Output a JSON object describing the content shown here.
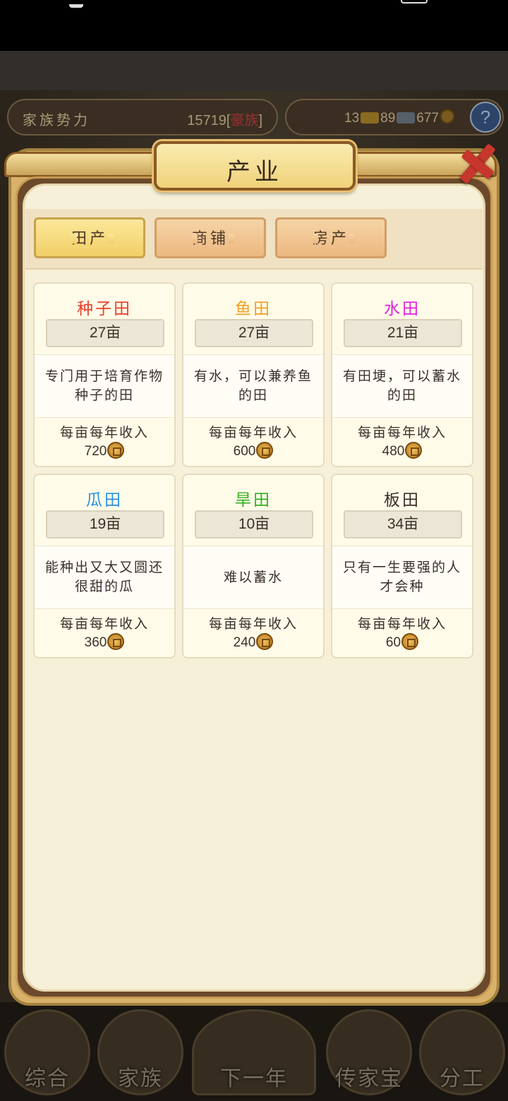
{
  "hud": {
    "power_label": "家族势力",
    "power_value": "15719",
    "power_rank_open": "[",
    "power_rank": "豪族",
    "power_rank_close": "]",
    "gold": "13",
    "silver": "89",
    "coins": "677",
    "help": "?"
  },
  "modal": {
    "title": "产业",
    "tabs": [
      {
        "label": "田产",
        "active": true
      },
      {
        "label": "商铺",
        "active": false
      },
      {
        "label": "房产",
        "active": false
      }
    ],
    "fields": [
      {
        "name": "种子田",
        "color": "#e8402a",
        "area": "27亩",
        "desc": "专门用于培育作物种子的田",
        "income_label": "每亩每年收入",
        "income": "720"
      },
      {
        "name": "鱼田",
        "color": "#f0a020",
        "area": "27亩",
        "desc": "有水，可以兼养鱼的田",
        "income_label": "每亩每年收入",
        "income": "600"
      },
      {
        "name": "水田",
        "color": "#e020e0",
        "area": "21亩",
        "desc": "有田埂，可以蓄水的田",
        "income_label": "每亩每年收入",
        "income": "480"
      },
      {
        "name": "瓜田",
        "color": "#2a90e0",
        "area": "19亩",
        "desc": "能种出又大又圆还很甜的瓜",
        "income_label": "每亩每年收入",
        "income": "360"
      },
      {
        "name": "旱田",
        "color": "#30b020",
        "area": "10亩",
        "desc": "难以蓄水",
        "income_label": "每亩每年收入",
        "income": "240"
      },
      {
        "name": "板田",
        "color": "#3a3028",
        "area": "34亩",
        "desc": "只有一生要强的人才会种",
        "income_label": "每亩每年收入",
        "income": "60"
      }
    ]
  },
  "bottom_nav": [
    {
      "label": "综合"
    },
    {
      "label": "家族"
    },
    {
      "label": "下一年"
    },
    {
      "label": "传家宝"
    },
    {
      "label": "分工"
    }
  ]
}
